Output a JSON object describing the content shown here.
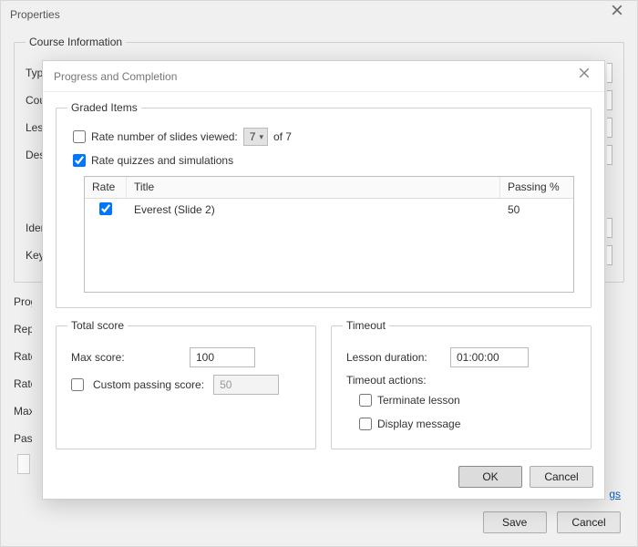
{
  "properties_window": {
    "title": "Properties",
    "course_info_legend": "Course Information",
    "row_labels": [
      "Type:",
      "Course:",
      "Lesson:",
      "Description:",
      "Identifier:",
      "Keywords:"
    ],
    "footer_labels": [
      "Progress:",
      "Repo:",
      "Rate:",
      "Rate:",
      "Max:",
      "Pass:"
    ],
    "hint_link_tail": "gs",
    "save_label": "Save",
    "cancel_label": "Cancel"
  },
  "dialog": {
    "title": "Progress and Completion",
    "graded_items": {
      "legend": "Graded Items",
      "rate_slides_label": "Rate number of slides viewed:",
      "rate_slides_checked": false,
      "slides_selected": "7",
      "slides_of": "of 7",
      "rate_quizzes_label": "Rate quizzes and simulations",
      "rate_quizzes_checked": true,
      "table": {
        "headers": {
          "rate": "Rate",
          "title": "Title",
          "passing": "Passing %"
        },
        "rows": [
          {
            "rate_checked": true,
            "title": "Everest (Slide 2)",
            "passing": "50"
          }
        ]
      }
    },
    "total_score": {
      "legend": "Total score",
      "max_label": "Max score:",
      "max_value": "100",
      "custom_label": "Custom passing score:",
      "custom_checked": false,
      "custom_value": "50"
    },
    "timeout": {
      "legend": "Timeout",
      "duration_label": "Lesson duration:",
      "duration_value": "01:00:00",
      "actions_label": "Timeout actions:",
      "terminate_label": "Terminate lesson",
      "terminate_checked": false,
      "display_label": "Display message",
      "display_checked": false
    },
    "ok_label": "OK",
    "cancel_label": "Cancel"
  }
}
